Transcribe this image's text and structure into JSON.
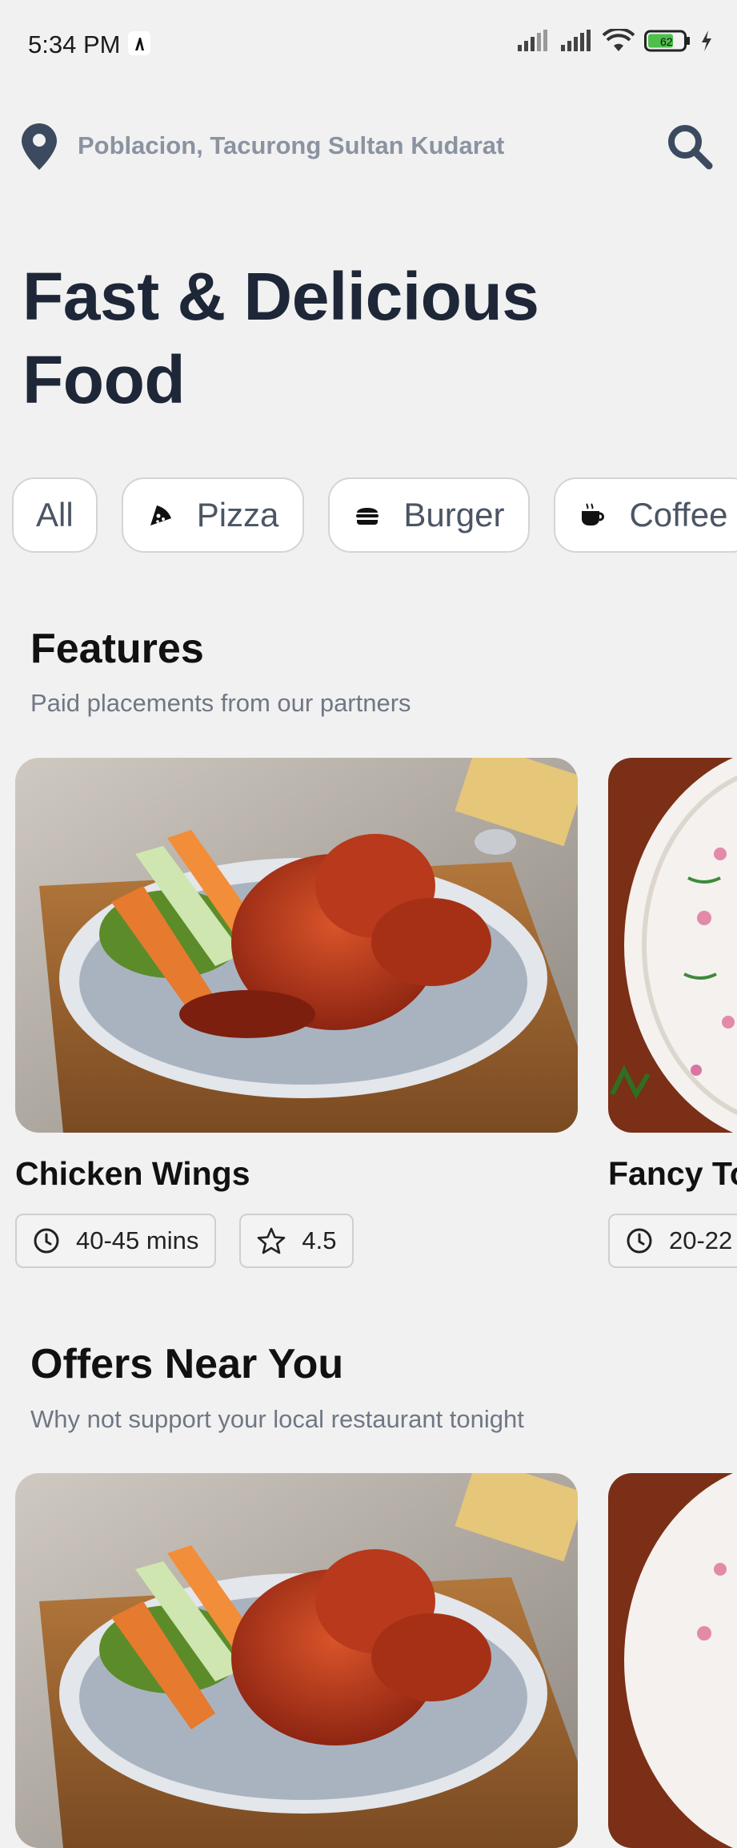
{
  "status_bar": {
    "time": "5:34 PM",
    "battery": "62"
  },
  "location": {
    "text": "Poblacion, Tacurong Sultan Kudarat"
  },
  "headline": {
    "line1": "Fast & Delicious",
    "line2": "Food"
  },
  "categories": [
    {
      "label": "All",
      "icon": ""
    },
    {
      "label": "Pizza",
      "icon": "pizza-icon"
    },
    {
      "label": "Burger",
      "icon": "burger-icon"
    },
    {
      "label": "Coffee",
      "icon": "coffee-icon"
    }
  ],
  "features": {
    "title": "Features",
    "subtitle": "Paid placements from our partners",
    "cards": [
      {
        "title": "Chicken Wings",
        "time": "40-45 mins",
        "rating": "4.5"
      },
      {
        "title": "Fancy To",
        "time": "20-22"
      }
    ]
  },
  "offers": {
    "title": "Offers Near You",
    "subtitle": "Why not support your local restaurant tonight"
  },
  "colors": {
    "accent": "#1e2738",
    "background": "#f1f1f1",
    "muted": "#8b93a1"
  }
}
